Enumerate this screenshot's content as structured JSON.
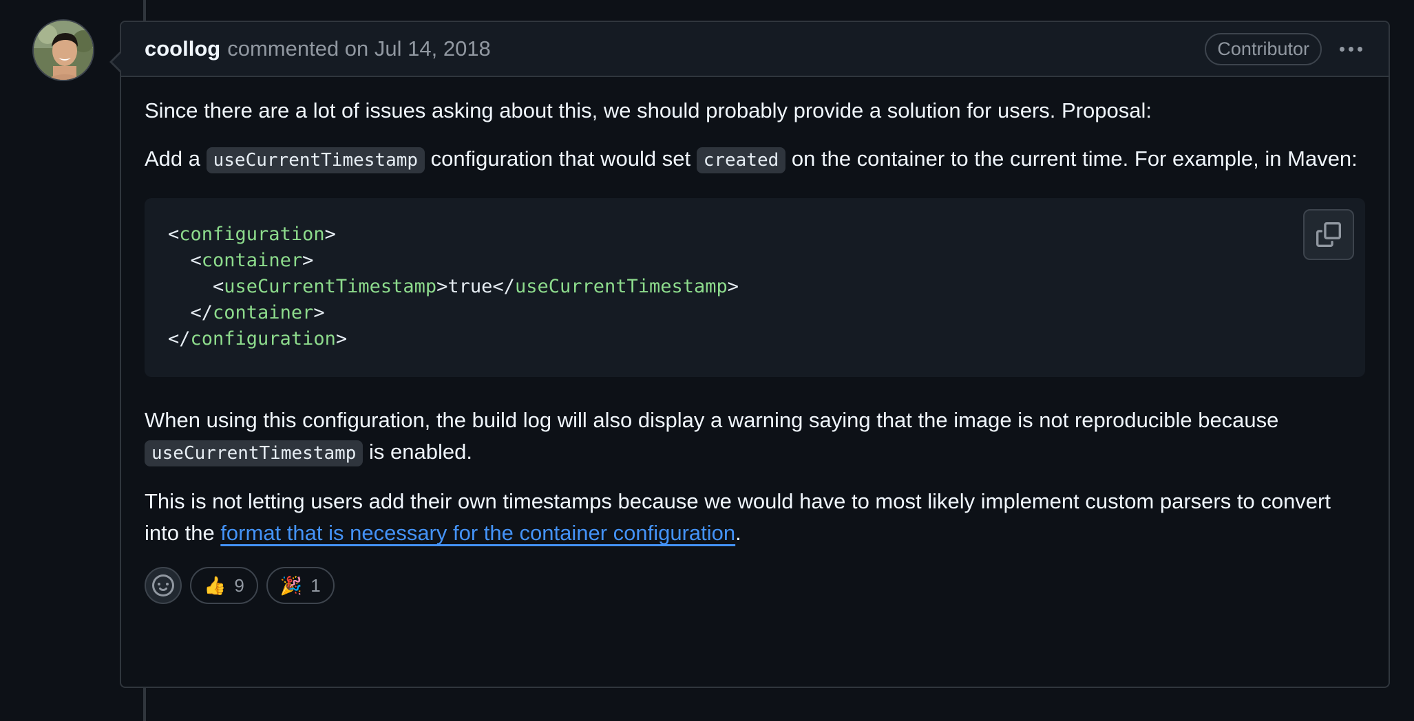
{
  "comment": {
    "author": "coollog",
    "meta": "commented on Jul 14, 2018",
    "role_badge": "Contributor"
  },
  "body": {
    "p1": "Since there are a lot of issues asking about this, we should probably provide a solution for users. Proposal:",
    "p2_a": "Add a ",
    "p2_code1": "useCurrentTimestamp",
    "p2_b": " configuration that would set ",
    "p2_code2": "created",
    "p2_c": " on the container to the current time. For example, in Maven:",
    "code_lines": {
      "l1_open": "<",
      "l1_tag": "configuration",
      "l1_close": ">",
      "l2_indent": "  <",
      "l2_tag": "container",
      "l2_close": ">",
      "l3_indent": "    <",
      "l3_tag": "useCurrentTimestamp",
      "l3_mid": ">true</",
      "l3_tag2": "useCurrentTimestamp",
      "l3_close": ">",
      "l4_indent": "  </",
      "l4_tag": "container",
      "l4_close": ">",
      "l5_open": "</",
      "l5_tag": "configuration",
      "l5_close": ">"
    },
    "p3_a": "When using this configuration, the build log will also display a warning saying that the image is not reproducible because ",
    "p3_code": "useCurrentTimestamp",
    "p3_b": " is enabled.",
    "p4_a": "This is not letting users add their own timestamps because we would have to most likely implement custom parsers to convert into the ",
    "p4_link": "format that is necessary for the container configuration",
    "p4_b": "."
  },
  "reactions": [
    {
      "emoji": "👍",
      "icon": "thumbs-up",
      "count": "9"
    },
    {
      "emoji": "🎉",
      "icon": "tada",
      "count": "1"
    }
  ],
  "icons": {
    "copy": "copy-icon",
    "smiley": "smiley-icon",
    "kebab": "kebab-horizontal-icon"
  },
  "colors": {
    "background": "#0d1117",
    "header_bg": "#151b23",
    "border": "#30363d",
    "text": "#f0f6fc",
    "muted": "#9198a1",
    "link": "#4493f8",
    "code_tag": "#8ddb8c"
  }
}
